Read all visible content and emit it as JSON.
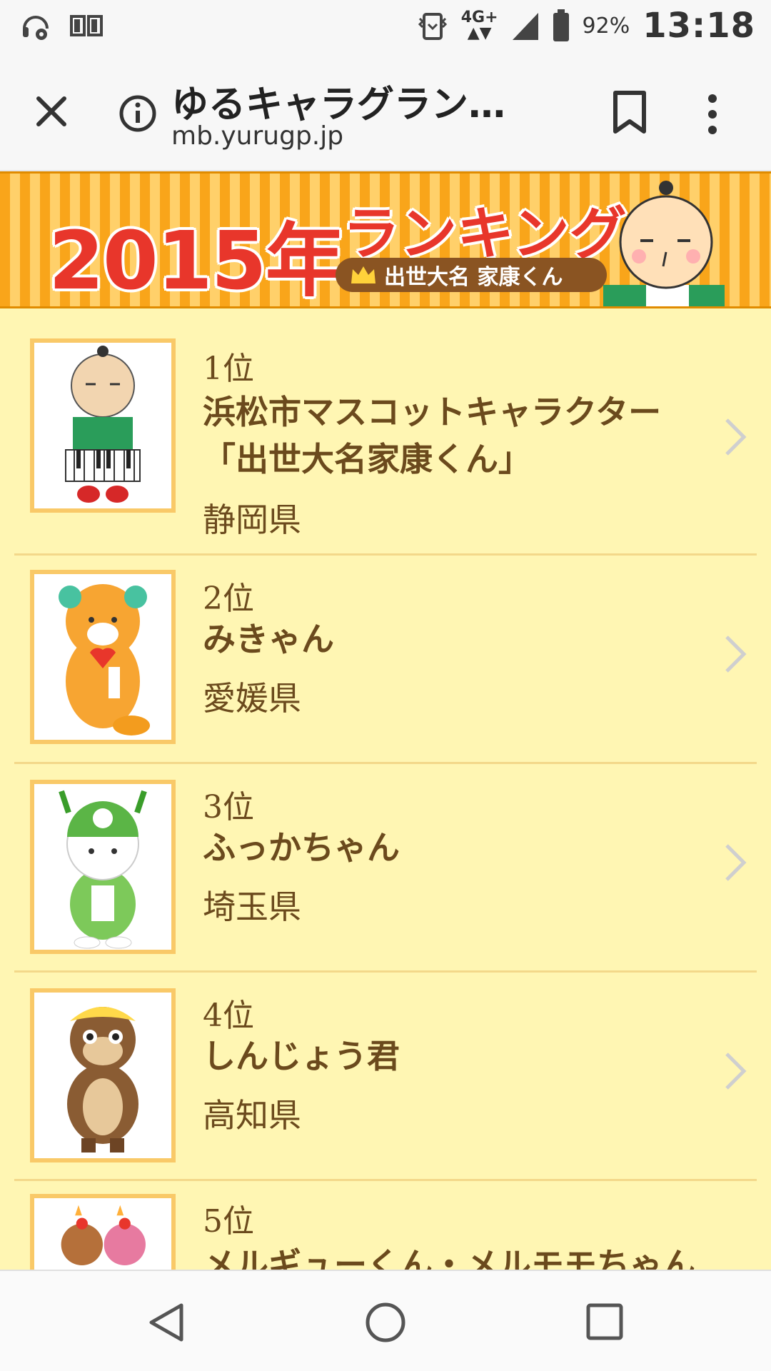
{
  "status_bar": {
    "network": "4G+",
    "battery": "92%",
    "time": "13:18"
  },
  "browser": {
    "title": "ゆるキャラグラン…",
    "url": "mb.yurugp.jp"
  },
  "banner": {
    "year": "2015年",
    "heading": "ランキング",
    "ribbon": "出世大名 家康くん"
  },
  "rankings": [
    {
      "rank": "1位",
      "name_line1": "浜松市マスコットキャラクター",
      "name_line2": "「出世大名家康くん」",
      "prefecture": "静岡県"
    },
    {
      "rank": "2位",
      "name_line1": "みきゃん",
      "name_line2": "",
      "prefecture": "愛媛県"
    },
    {
      "rank": "3位",
      "name_line1": "ふっかちゃん",
      "name_line2": "",
      "prefecture": "埼玉県"
    },
    {
      "rank": "4位",
      "name_line1": "しんじょう君",
      "name_line2": "",
      "prefecture": "高知県"
    },
    {
      "rank": "5位",
      "name_line1": "メルギューくん・メルモモちゃん",
      "name_line2": "",
      "prefecture": ""
    }
  ]
}
